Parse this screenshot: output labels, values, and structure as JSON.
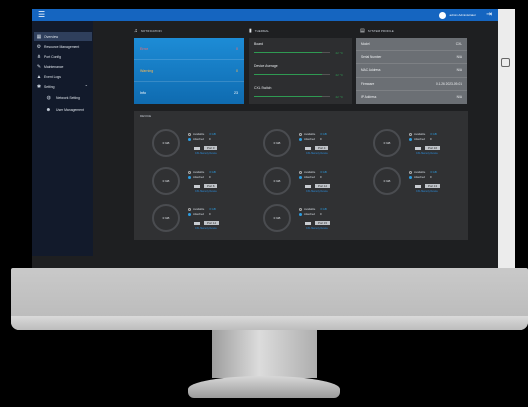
{
  "topbar": {
    "menu_icon": "menu-icon",
    "user_name": "admin Administrator",
    "logout_icon": "logout-icon"
  },
  "sidebar": {
    "items": [
      {
        "label": "Overview",
        "icon": "grid-icon",
        "active": true
      },
      {
        "label": "Resource Management",
        "icon": "gear-icon"
      },
      {
        "label": "Port Config",
        "icon": "network-icon"
      },
      {
        "label": "Maintenance",
        "icon": "wrench-icon"
      },
      {
        "label": "Event Logs",
        "icon": "alert-icon"
      },
      {
        "label": "Setting",
        "icon": "settings-icon"
      },
      {
        "label": "Network Setting",
        "icon": "globe-icon",
        "sub": true
      },
      {
        "label": "User Management",
        "icon": "users-icon",
        "sub": true
      }
    ]
  },
  "notification": {
    "title": "NOTIFICATION",
    "rows": [
      {
        "label": "Error",
        "value": "0"
      },
      {
        "label": "Warning",
        "value": "0"
      },
      {
        "label": "Info",
        "value": "23"
      }
    ]
  },
  "thermal": {
    "title": "THERMAL",
    "rows": [
      {
        "label": "Board",
        "value": "22 °C",
        "level": 0.9
      },
      {
        "label": "Device Average",
        "value": "22 °C",
        "level": 0.9
      },
      {
        "label": "CXL Switch",
        "value": "22 °C",
        "level": 0.9
      }
    ]
  },
  "system_profile": {
    "title": "SYSTEM PROFILE",
    "rows": [
      {
        "key": "Model",
        "value": "CXL"
      },
      {
        "key": "Serial Number",
        "value": "N/A"
      },
      {
        "key": "MAC Address",
        "value": "N/A"
      },
      {
        "key": "Firmware",
        "value": "0.1.26 2023-09-01"
      },
      {
        "key": "IP Address",
        "value": "N/A"
      }
    ]
  },
  "ports": {
    "title": "DEVICE",
    "items": [
      {
        "usage": "0 GB",
        "available": "0 GB",
        "attached": "0",
        "port": "Port 0",
        "link": "CXL Memory Device"
      },
      {
        "usage": "0 GB",
        "available": "0 GB",
        "attached": "0",
        "port": "Port 4",
        "link": "CXL Memory Device"
      },
      {
        "usage": "0 GB",
        "available": "0 GB",
        "attached": "0",
        "port": "Port 16",
        "link": "CXL Memory Device"
      },
      {
        "usage": "0 GB",
        "available": "0 GB",
        "attached": "0",
        "port": "Port 8",
        "link": "CXL Memory Device"
      },
      {
        "usage": "0 GB",
        "available": "0 GB",
        "attached": "0",
        "port": "Port 12",
        "link": "CXL Memory Device"
      },
      {
        "usage": "0 GB",
        "available": "0 GB",
        "attached": "0",
        "port": "Port 13",
        "link": "CXL Memory Device"
      },
      {
        "usage": "0 GB",
        "available": "0 GB",
        "attached": "0",
        "port": "Port 14",
        "link": "CXL Memory Device"
      },
      {
        "usage": "0 GB",
        "available": "0 GB",
        "attached": "0",
        "port": "Port 15",
        "link": "CXL Memory Device"
      }
    ],
    "available_label": "Available",
    "attached_label": "Attached"
  },
  "colors": {
    "topbar": "#1565c0",
    "sidebar": "#121a2b",
    "accent": "#2a9de2",
    "ok": "#2f9a52"
  }
}
